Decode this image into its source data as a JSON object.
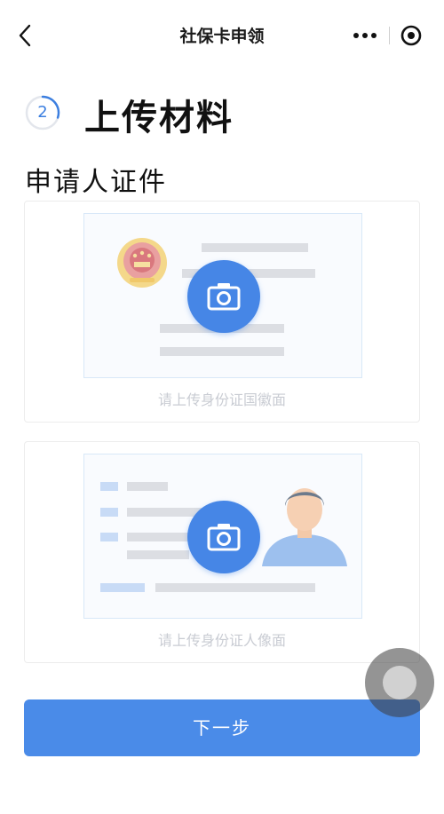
{
  "nav": {
    "title": "社保卡申领",
    "back_icon": "chevron-left-icon",
    "more_icon": "more-dots-icon",
    "close_icon": "target-circle-icon"
  },
  "step": {
    "number": "2",
    "title": "上传材料"
  },
  "section": {
    "title": "申请人证件"
  },
  "uploads": [
    {
      "caption": "请上传身份证国徽面",
      "icon": "camera-icon"
    },
    {
      "caption": "请上传身份证人像面",
      "icon": "camera-icon"
    }
  ],
  "next_button": {
    "label": "下一步"
  },
  "colors": {
    "accent": "#4a8be8",
    "camera_bg": "#4686e6",
    "caption": "#c9ccd3"
  }
}
